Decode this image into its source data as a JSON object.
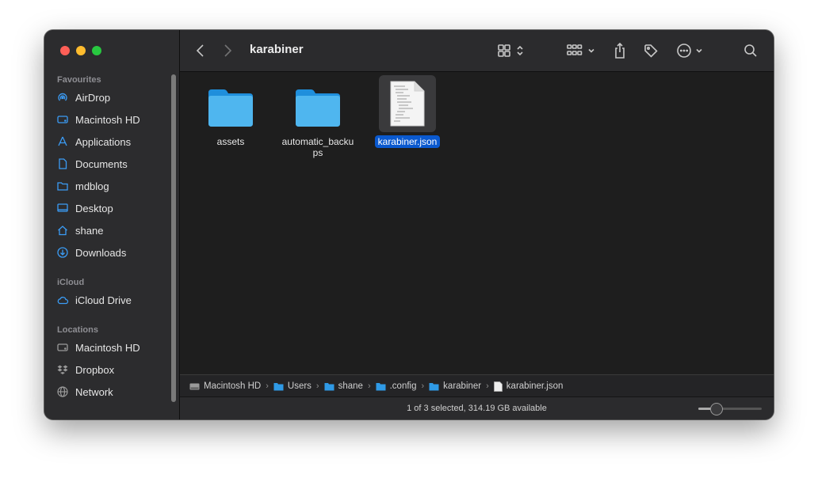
{
  "window": {
    "title": "karabiner"
  },
  "sidebar": {
    "favourites_label": "Favourites",
    "favourites": [
      {
        "label": "AirDrop",
        "icon": "airdrop-icon"
      },
      {
        "label": "Macintosh HD",
        "icon": "hard-drive-icon"
      },
      {
        "label": "Applications",
        "icon": "applications-icon"
      },
      {
        "label": "Documents",
        "icon": "document-icon"
      },
      {
        "label": "mdblog",
        "icon": "folder-icon"
      },
      {
        "label": "Desktop",
        "icon": "desktop-icon"
      },
      {
        "label": "shane",
        "icon": "home-icon"
      },
      {
        "label": "Downloads",
        "icon": "download-icon"
      }
    ],
    "icloud_label": "iCloud",
    "icloud": [
      {
        "label": "iCloud Drive",
        "icon": "cloud-icon"
      }
    ],
    "locations_label": "Locations",
    "locations": [
      {
        "label": "Macintosh HD",
        "icon": "hard-drive-icon"
      },
      {
        "label": "Dropbox",
        "icon": "dropbox-icon"
      },
      {
        "label": "Network",
        "icon": "globe-icon"
      }
    ]
  },
  "files": [
    {
      "name": "assets",
      "kind": "folder"
    },
    {
      "name": "automatic_backu\nps",
      "kind": "folder"
    },
    {
      "name": "karabiner.json",
      "kind": "file",
      "selected": true
    }
  ],
  "pathbar": [
    {
      "label": "Macintosh HD",
      "icon": "hard-drive-icon"
    },
    {
      "label": "Users",
      "icon": "folder-icon"
    },
    {
      "label": "shane",
      "icon": "folder-icon"
    },
    {
      "label": ".config",
      "icon": "folder-icon"
    },
    {
      "label": "karabiner",
      "icon": "folder-icon"
    },
    {
      "label": "karabiner.json",
      "icon": "file-icon"
    }
  ],
  "status": {
    "text": "1 of 3 selected, 314.19 GB available",
    "zoom": 0.28
  },
  "colors": {
    "accent": "#0a59cf",
    "folder": "#4fb6ef"
  }
}
